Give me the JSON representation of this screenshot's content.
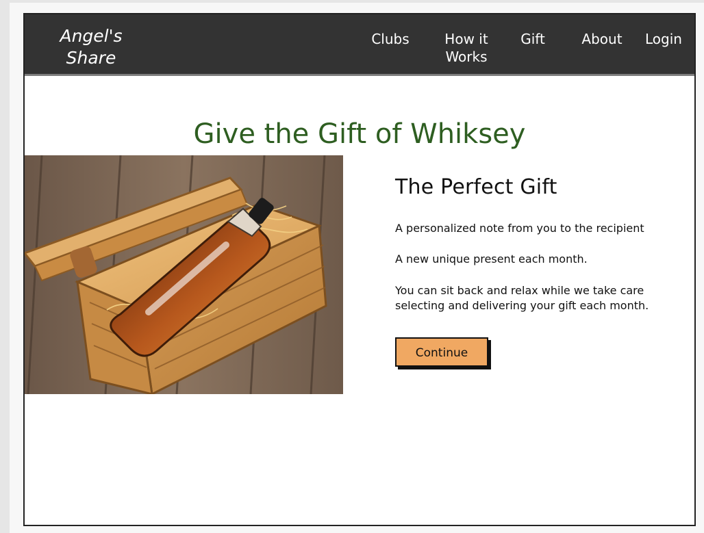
{
  "nav": {
    "brand_line1": "Angel's",
    "brand_line2": "Share",
    "items": [
      {
        "label": "Clubs"
      },
      {
        "label_line1": "How it",
        "label_line2": "Works"
      },
      {
        "label": "Gift"
      },
      {
        "label": "About"
      },
      {
        "label": "Login"
      }
    ]
  },
  "hero": {
    "title": "Give the Gift of Whiksey"
  },
  "content": {
    "heading": "The Perfect Gift",
    "bullets": [
      "A personalized note from you to the recipient",
      "A new unique present each month.",
      "You can sit back and relax while we take care selecting and delivering your gift each month."
    ],
    "button_label": "Continue"
  },
  "colors": {
    "navbar": "#333333",
    "heading_green": "#2e5e21",
    "button_fill": "#f0a862"
  },
  "icons": {
    "product_image": "whiskey-gift-box-image"
  }
}
